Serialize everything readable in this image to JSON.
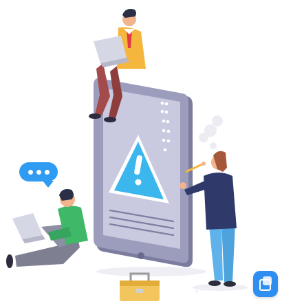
{
  "illustration": {
    "subject": "warning-alert-scene",
    "icons": [
      "warning-triangle-icon",
      "chat-bubble-icon",
      "laptop-icon",
      "toolbox-icon",
      "pencil-icon",
      "app-badge-icon"
    ],
    "colors": {
      "accent_blue": "#2f9bf2",
      "phone_body": "#8e8fb3",
      "phone_screen": "#c7c8dc",
      "warning_fill": "#3cb7ee",
      "man_top_jacket": "#f5b63e",
      "man_top_pants": "#a54a4a",
      "man_sitting_shirt": "#3fb868",
      "man_sitting_pants": "#7e8092",
      "man_right_jacket": "#2f3a6b",
      "man_right_pants": "#5fb3ea",
      "toolbox": "#f2c65c",
      "skin": "#f1b48c"
    }
  }
}
